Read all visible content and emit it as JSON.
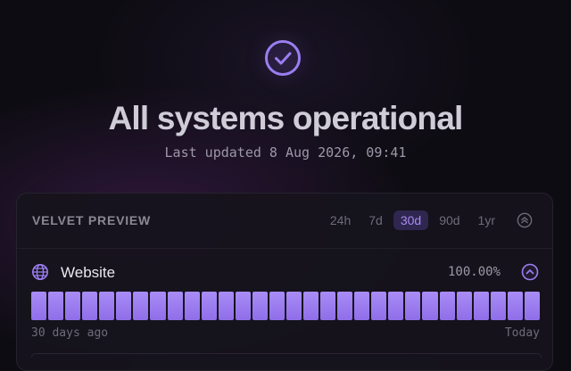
{
  "hero": {
    "status_icon": "check-circle-icon",
    "title": "All systems operational",
    "subtitle": "Last updated 8 Aug 2026, 09:41",
    "accent_color": "#9b7ef0"
  },
  "card": {
    "title": "VELVET PREVIEW",
    "ranges": [
      "24h",
      "7d",
      "30d",
      "90d",
      "1yr"
    ],
    "active_range": "30d",
    "collapse_icon": "chevrons-up-icon"
  },
  "monitor": {
    "icon": "globe-icon",
    "name": "Website",
    "uptime": "100.00%",
    "toggle_icon": "chevron-up-icon",
    "day_count": 30,
    "day_status": [
      "up",
      "up",
      "up",
      "up",
      "up",
      "up",
      "up",
      "up",
      "up",
      "up",
      "up",
      "up",
      "up",
      "up",
      "up",
      "up",
      "up",
      "up",
      "up",
      "up",
      "up",
      "up",
      "up",
      "up",
      "up",
      "up",
      "up",
      "up",
      "up",
      "up"
    ],
    "axis_start": "30 days ago",
    "axis_end": "Today"
  }
}
